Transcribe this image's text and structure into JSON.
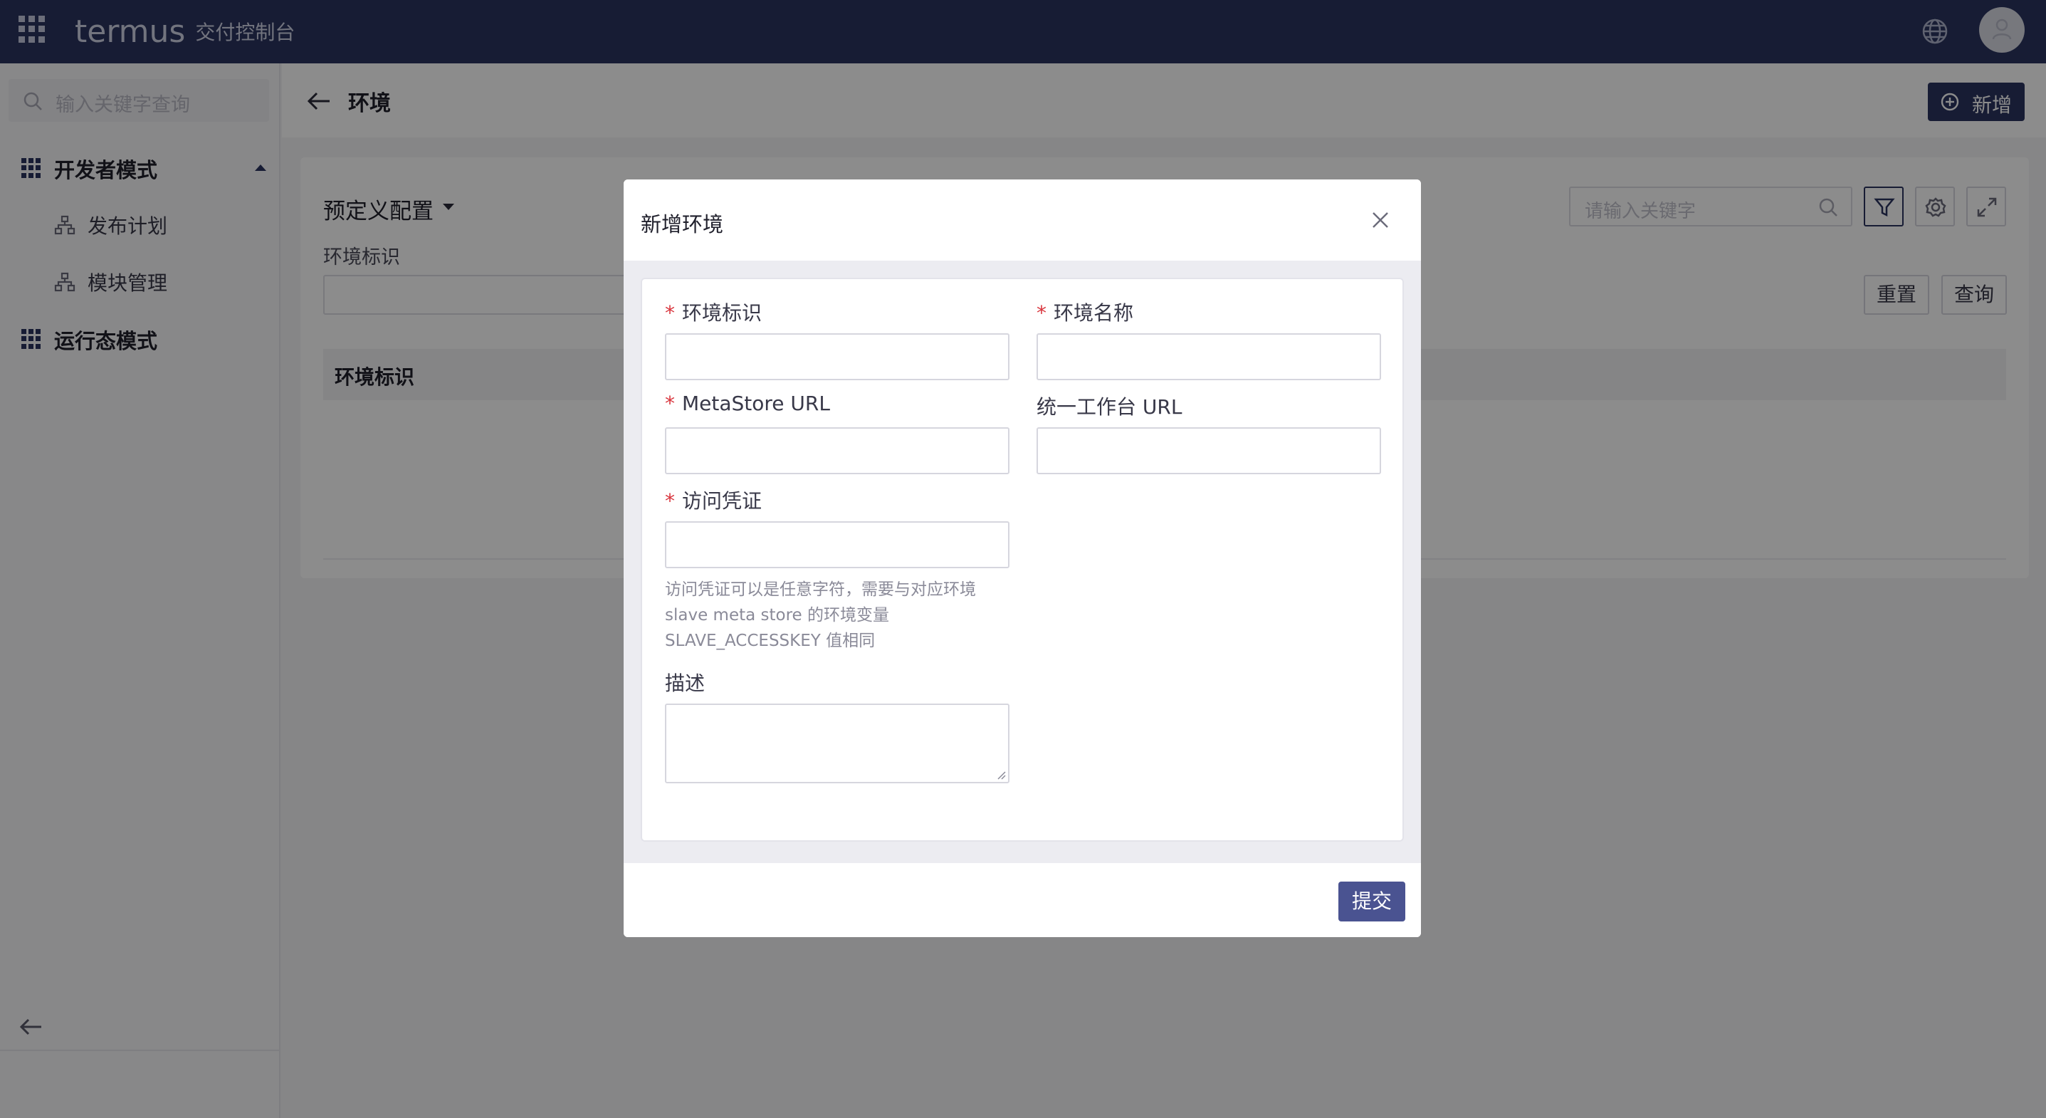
{
  "topbar": {
    "brand_logo": "termus",
    "brand_sub": "交付控制台"
  },
  "sidebar": {
    "search_placeholder": "输入关键字查询",
    "groups": [
      {
        "label": "开发者模式",
        "expanded": true,
        "items": [
          {
            "label": "发布计划"
          },
          {
            "label": "模块管理"
          }
        ]
      },
      {
        "label": "运行态模式",
        "expanded": false,
        "items": []
      }
    ]
  },
  "page": {
    "title": "环境",
    "new_button": "新增",
    "preset_label": "预定义配置",
    "filter_label": "环境标识",
    "keyword_placeholder": "请输入关键字",
    "reset_button": "重置",
    "query_button": "查询",
    "table_columns": [
      "环境标识"
    ]
  },
  "modal": {
    "title": "新增环境",
    "fields": {
      "env_id": {
        "label": "环境标识",
        "required": true,
        "value": ""
      },
      "env_name": {
        "label": "环境名称",
        "required": true,
        "value": ""
      },
      "metastore_url": {
        "label": "MetaStore URL",
        "required": true,
        "value": ""
      },
      "workbench_url": {
        "label": "统一工作台 URL",
        "required": false,
        "value": ""
      },
      "access_key": {
        "label": "访问凭证",
        "required": true,
        "value": "",
        "help_lines": [
          "访问凭证可以是任意字符，需要与对应环境",
          "slave meta store 的环境变量",
          "SLAVE_ACCESSKEY 值相同"
        ]
      },
      "description": {
        "label": "描述",
        "required": false,
        "value": ""
      }
    },
    "submit_button": "提交"
  },
  "colors": {
    "topbar": "#2a3360",
    "primary_button": "#4a5391",
    "required_mark": "#d9363e"
  }
}
